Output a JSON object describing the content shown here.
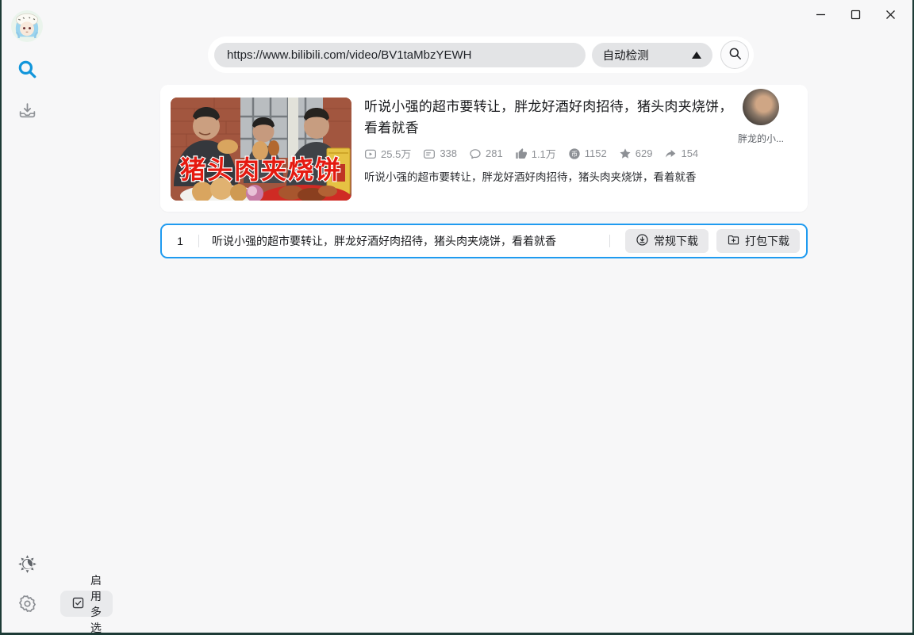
{
  "window": {
    "app_background": "#f7f7f8",
    "frame_color": "#1d3b36"
  },
  "search": {
    "url_value": "https://www.bilibili.com/video/BV1taMbzYEWH",
    "detect_mode_label": "自动检测"
  },
  "video_card": {
    "title": "听说小强的超市要转让，胖龙好酒好肉招待，猪头肉夹烧饼，看着就香",
    "thumbnail_caption": "猪头肉夹烧饼",
    "stats": [
      {
        "icon": "play-count-icon",
        "value": "25.5万"
      },
      {
        "icon": "danmaku-icon",
        "value": "338"
      },
      {
        "icon": "comment-icon",
        "value": "281"
      },
      {
        "icon": "like-icon",
        "value": "1.1万"
      },
      {
        "icon": "coin-icon",
        "value": "1152"
      },
      {
        "icon": "favorite-icon",
        "value": "629"
      },
      {
        "icon": "share-icon",
        "value": "154"
      }
    ],
    "coin_glyph": "币",
    "description": "听说小强的超市要转让，胖龙好酒好肉招待，猪头肉夹烧饼，看着就香",
    "uploader_name": "胖龙的小..."
  },
  "download_row": {
    "index": "1",
    "title": "听说小强的超市要转让，胖龙好酒好肉招待，猪头肉夹烧饼，看着就香",
    "regular_download_label": "常规下载",
    "package_download_label": "打包下载"
  },
  "sidebar": {
    "enable_multiselect_label": "启用多选"
  },
  "colors": {
    "accent_blue": "#1296db",
    "row_border_blue": "#1f9bf0",
    "pill_gray": "#e3e4e6",
    "button_gray": "#e9e9eb",
    "stat_gray": "#8d9095",
    "thumbnail_caption_red": "#e51a10"
  }
}
